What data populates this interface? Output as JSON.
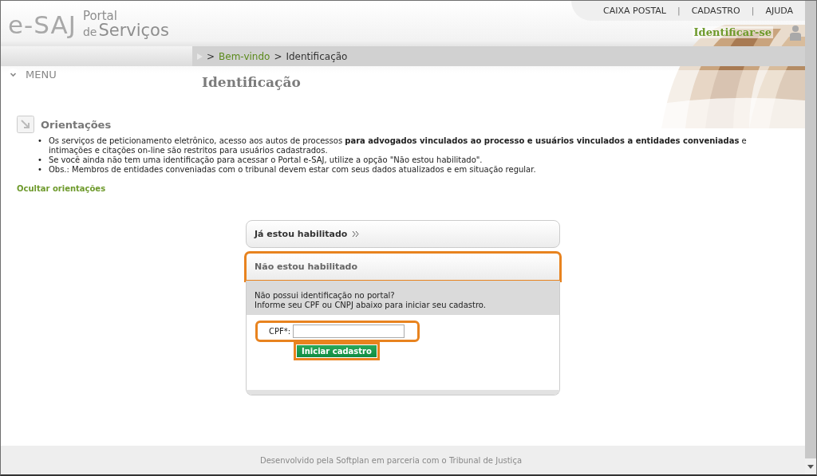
{
  "header": {
    "logo": {
      "mark": "e-SAJ",
      "line_1": "Portal",
      "line_2_prefix": "de",
      "line_2": "Serviços"
    },
    "top_links": [
      {
        "kind": "link",
        "text": "CAIXA POSTAL"
      },
      {
        "kind": "separator",
        "text": "|"
      },
      {
        "kind": "link",
        "text": "CADASTRO"
      },
      {
        "kind": "separator",
        "text": "|"
      },
      {
        "kind": "link",
        "text": "AJUDA"
      }
    ],
    "login": "Identificar-se",
    "breadcrumb": [
      {
        "kind": "separator",
        "text": ">"
      },
      {
        "kind": "link",
        "text": "Bem-vindo"
      },
      {
        "kind": "separator",
        "text": ">"
      },
      {
        "kind": "current",
        "text": "Identificação"
      }
    ],
    "menu": "MENU",
    "page_title": "Identificação"
  },
  "guidance": {
    "title": "Orientações",
    "items": [
      {
        "bullet": "•",
        "text": "Os serviços de peticionamento eletrônico, acesso aos autos de processos **para advogados vinculados ao processo e usuários vinculados a entidades conveniadas** e intimações e citações on-line são restritos para usuários cadastrados."
      },
      {
        "bullet": "•",
        "text": "Se você ainda não tem uma identificação para acessar o Portal e-SAJ, utilize a opção \"Não estou habilitado\"."
      },
      {
        "bullet": "•",
        "text": "Obs.: Membros de entidades conveniadas com o tribunal devem estar com seus dados atualizados e em situação regular."
      }
    ],
    "hide_link": "Ocultar orientações"
  },
  "panels": [
    {
      "title": "Já estou habilitado",
      "expanded": false,
      "highlighted": false
    },
    {
      "title": "Não estou habilitado",
      "expanded": true,
      "highlighted": true,
      "message": [
        "Não possui identificação no portal?",
        "Informe seu CPF ou CNPJ abaixo para iniciar seu cadastro."
      ],
      "field": {
        "label": "CPF*:",
        "highlighted": true
      },
      "button": {
        "label": "Iniciar cadastro",
        "highlighted": true
      }
    }
  ],
  "footer": "Desenvolvido pela Softplan em parceria com o Tribunal de Justiça"
}
